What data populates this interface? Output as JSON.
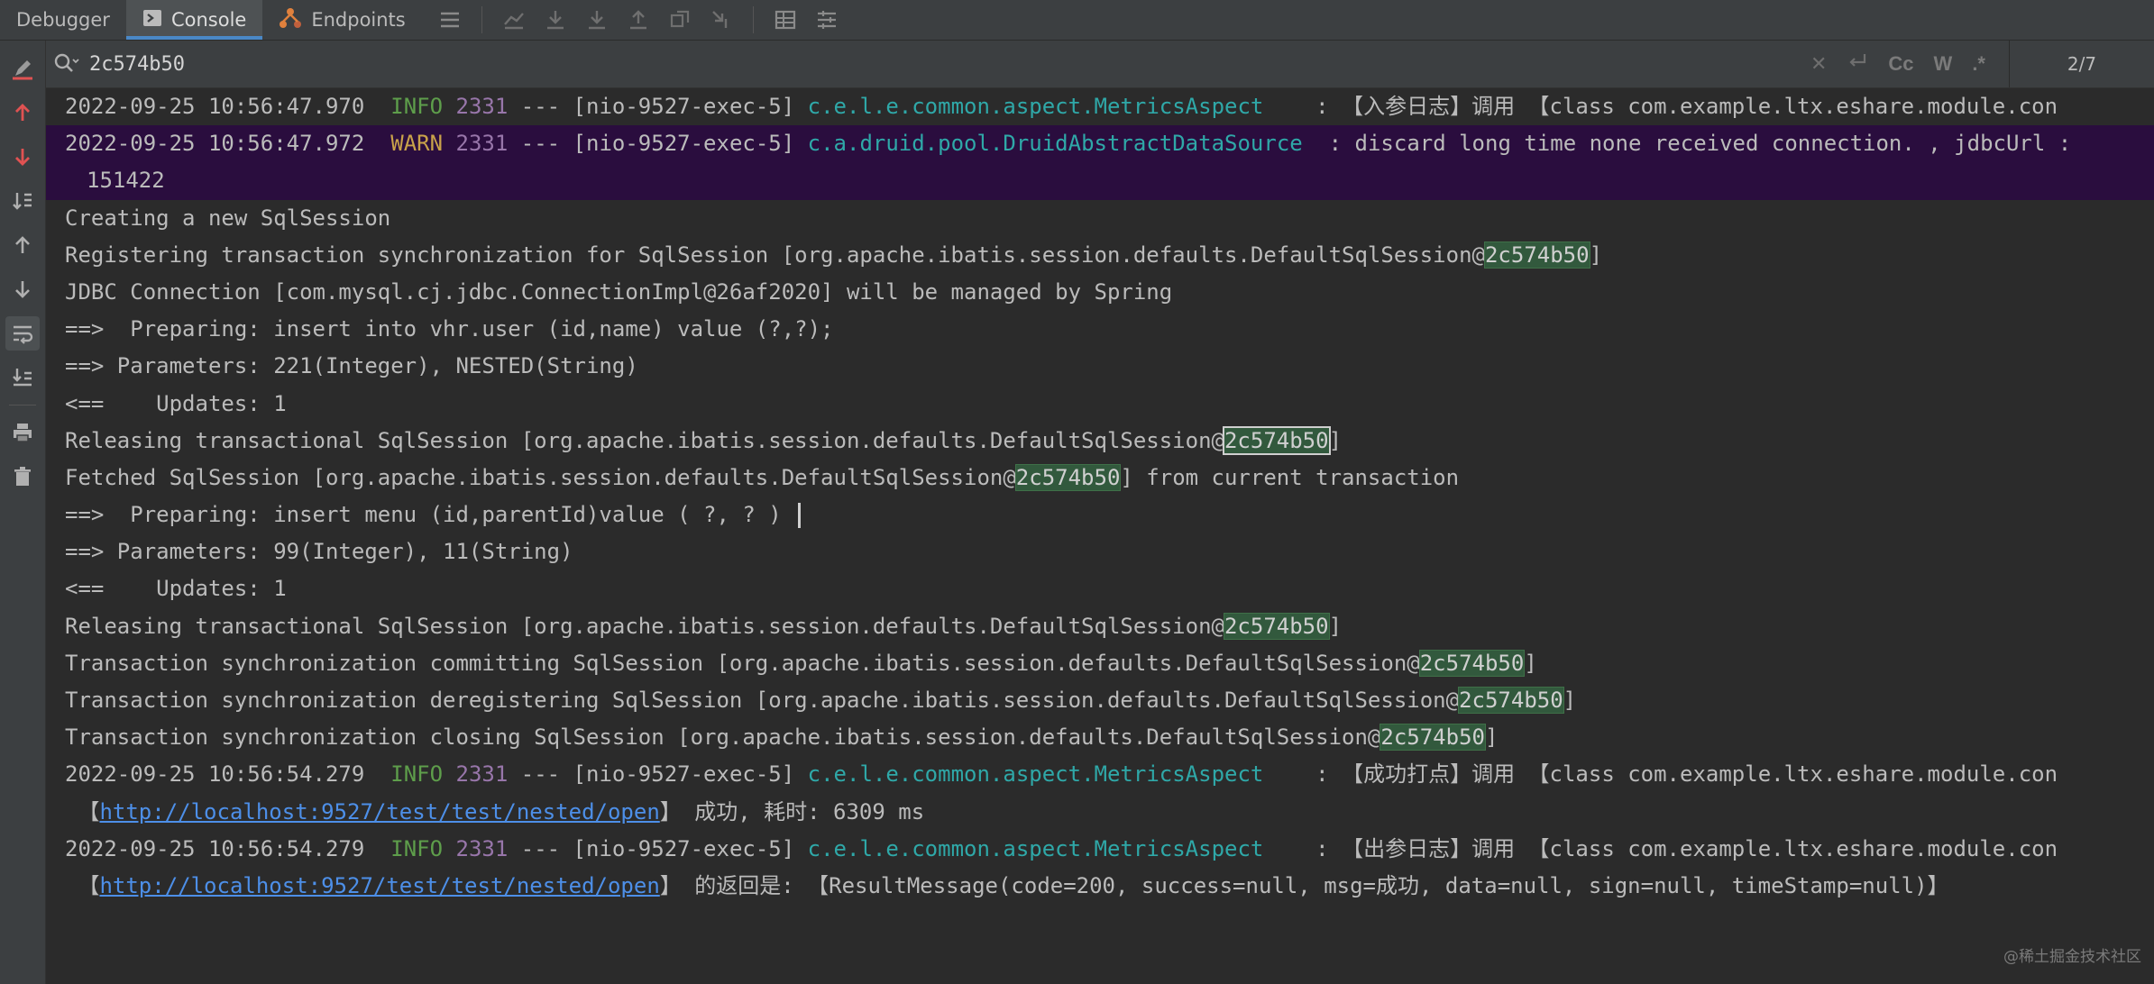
{
  "tabs": {
    "debugger": "Debugger",
    "console": "Console",
    "endpoints": "Endpoints"
  },
  "search": {
    "value": "2c574b50",
    "case_label": "Cc",
    "word_label": "W",
    "regex_label": ".*",
    "match_count": "2/7"
  },
  "log": {
    "l1": {
      "ts": "2022-09-25 10:56:47.970",
      "lvl": "INFO",
      "pid": "2331",
      "thr": "--- [nio-9527-exec-5]",
      "cls": "c.e.l.e.common.aspect.MetricsAspect",
      "msg": "    : 【入参日志】调用 【class com.example.ltx.eshare.module.con"
    },
    "l2": {
      "ts": "2022-09-25 10:56:47.972",
      "lvl": "WARN",
      "pid": "2331",
      "thr": "--- [nio-9527-exec-5]",
      "cls": "c.a.druid.pool.DruidAbstractDataSource",
      "msg": "  : discard long time none received connection. , jdbcUrl :"
    },
    "l2b": "151422",
    "l3": "Creating a new SqlSession",
    "l4a": "Registering transaction synchronization for SqlSession [org.apache.ibatis.session.defaults.DefaultSqlSession@",
    "l5": "JDBC Connection [com.mysql.cj.jdbc.ConnectionImpl@26af2020] will be managed by Spring",
    "l6": "==>  Preparing: insert into vhr.user (id,name) value (?,?);",
    "l7": "==> Parameters: 221(Integer), NESTED(String)",
    "l8": "<==    Updates: 1",
    "l9a": "Releasing transactional SqlSession [org.apache.ibatis.session.defaults.DefaultSqlSession@",
    "l10a": "Fetched SqlSession [org.apache.ibatis.session.defaults.DefaultSqlSession@",
    "l10b": "] from current transaction",
    "l11": "==>  Preparing: insert menu (id,parentId)value ( ?, ? ) ",
    "l12": "==> Parameters: 99(Integer), 11(String)",
    "l13": "<==    Updates: 1",
    "l14a": "Releasing transactional SqlSession [org.apache.ibatis.session.defaults.DefaultSqlSession@",
    "l15a": "Transaction synchronization committing SqlSession [org.apache.ibatis.session.defaults.DefaultSqlSession@",
    "l16a": "Transaction synchronization deregistering SqlSession [org.apache.ibatis.session.defaults.DefaultSqlSession@",
    "l17a": "Transaction synchronization closing SqlSession [org.apache.ibatis.session.defaults.DefaultSqlSession@",
    "l18": {
      "ts": "2022-09-25 10:56:54.279",
      "lvl": "INFO",
      "pid": "2331",
      "thr": "--- [nio-9527-exec-5]",
      "cls": "c.e.l.e.common.aspect.MetricsAspect",
      "msg": "    : 【成功打点】调用 【class com.example.ltx.eshare.module.con"
    },
    "l18b_pre": "【",
    "l18b_link": "http://localhost:9527/test/test/nested/open",
    "l18b_post": "】 成功, 耗时: 6309 ms",
    "l19": {
      "ts": "2022-09-25 10:56:54.279",
      "lvl": "INFO",
      "pid": "2331",
      "thr": "--- [nio-9527-exec-5]",
      "cls": "c.e.l.e.common.aspect.MetricsAspect",
      "msg": "    : 【出参日志】调用 【class com.example.ltx.eshare.module.con"
    },
    "l19b_pre": "【",
    "l19b_link": "http://localhost:9527/test/test/nested/open",
    "l19b_post": "】 的返回是: 【ResultMessage(code=200, success=null, msg=成功, data=null, sign=null, timeStamp=null)】",
    "match": "2c574b50",
    "close_bracket": "]"
  },
  "watermark": "@稀土掘金技术社区"
}
